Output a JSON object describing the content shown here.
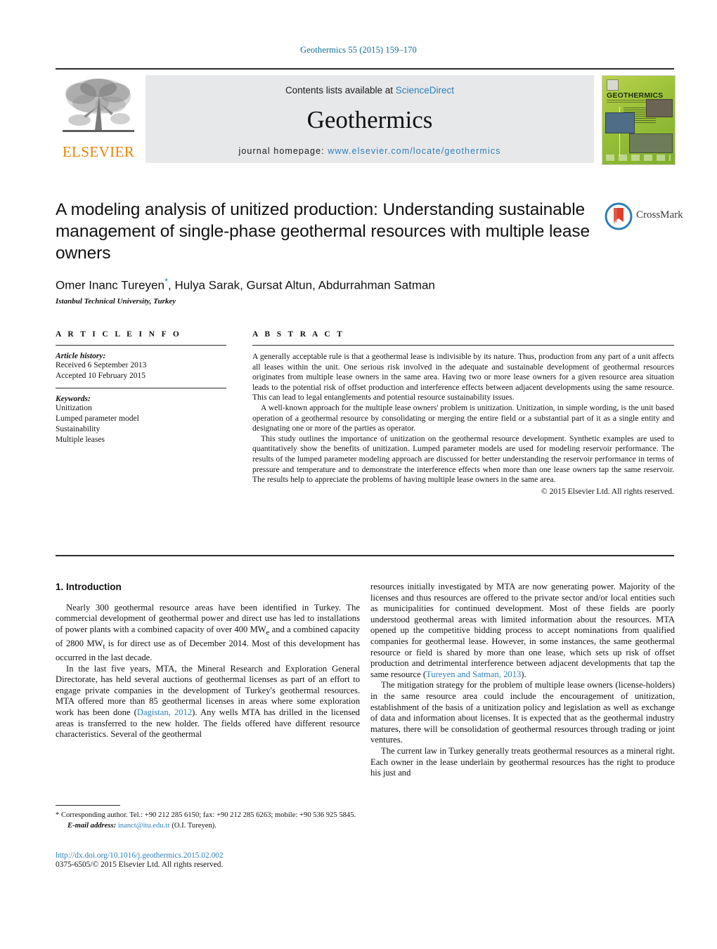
{
  "running_head": "Geothermics 55 (2015) 159–170",
  "masthead": {
    "contents_prefix": "Contents lists available at ",
    "contents_link": "ScienceDirect",
    "journal_name": "Geothermics",
    "homepage_label": "journal homepage:",
    "homepage_url": "www.elsevier.com/locate/geothermics",
    "publisher_logo_text": "ELSEVIER",
    "cover_title": "GEOTHERMICS"
  },
  "article": {
    "title": "A modeling analysis of unitized production: Understanding sustainable management of single-phase geothermal resources with multiple lease owners",
    "authors": "Omer Inanc Tureyen",
    "corresponding_marker": "*",
    "authors_rest": ", Hulya Sarak, Gursat Altun, Abdurrahman Satman",
    "affiliation": "Istanbul Technical University, Turkey",
    "crossmark_label": "CrossMark"
  },
  "article_info": {
    "heading": "A R T I C L E   I N F O",
    "history_label": "Article history:",
    "received": "Received 6 September 2013",
    "accepted": "Accepted 10 February 2015",
    "keywords_label": "Keywords:",
    "keywords": [
      "Unitization",
      "Lumped parameter model",
      "Sustainability",
      "Multiple leases"
    ]
  },
  "abstract": {
    "heading": "A B S T R A C T",
    "paragraphs": [
      "A generally acceptable rule is that a geothermal lease is indivisible by its nature. Thus, production from any part of a unit affects all leases within the unit. One serious risk involved in the adequate and sustainable development of geothermal resources originates from multiple lease owners in the same area. Having two or more lease owners for a given resource area situation leads to the potential risk of offset production and interference effects between adjacent developments using the same resource. This can lead to legal entanglements and potential resource sustainability issues.",
      "A well-known approach for the multiple lease owners' problem is unitization. Unitization, in simple wording, is the unit based operation of a geothermal resource by consolidating or merging the entire field or a substantial part of it as a single entity and designating one or more of the parties as operator.",
      "This study outlines the importance of unitization on the geothermal resource development. Synthetic examples are used to quantitatively show the benefits of unitization. Lumped parameter models are used for modeling reservoir performance. The results of the lumped parameter modeling approach are discussed for better understanding the reservoir performance in terms of pressure and temperature and to demonstrate the interference effects when more than one lease owners tap the same reservoir. The results help to appreciate the problems of having multiple lease owners in the same area."
    ],
    "copyright": "© 2015 Elsevier Ltd. All rights reserved."
  },
  "body": {
    "section_heading": "1. Introduction",
    "left_paragraphs": [
      "Nearly 300 geothermal resource areas have been identified in Turkey. The commercial development of geothermal power and direct use has led to installations of power plants with a combined capacity of over 400 MWe and a combined capacity of 2800 MWt is for direct use as of December 2014. Most of this development has occurred in the last decade.",
      "In the last five years, MTA, the Mineral Research and Exploration General Directorate, has held several auctions of geothermal licenses as part of an effort to engage private companies in the development of Turkey's geothermal resources. MTA offered more than 85 geothermal licenses in areas where some exploration work has been done (Dagistan, 2012). Any wells MTA has drilled in the licensed areas is transferred to the new holder. The fields offered have different resource characteristics. Several of the geothermal"
    ],
    "left_ref_link": "Dagistan, 2012",
    "right_paragraphs": [
      "resources initially investigated by MTA are now generating power. Majority of the licenses and thus resources are offered to the private sector and/or local entities such as municipalities for continued development. Most of these fields are poorly understood geothermal areas with limited information about the resources. MTA opened up the competitive bidding process to accept nominations from qualified companies for geothermal lease. However, in some instances, the same geothermal resource or field is shared by more than one lease, which sets up risk of offset production and detrimental interference between adjacent developments that tap the same resource (Tureyen and Satman, 2013).",
      "The mitigation strategy for the problem of multiple lease owners (license-holders) in the same resource area could include the encouragement of unitization, establishment of the basis of a unitization policy and legislation as well as exchange of data and information about licenses. It is expected that as the geothermal industry matures, there will be consolidation of geothermal resources through trading or joint ventures.",
      "The current law in Turkey generally treats geothermal resources as a mineral right. Each owner in the lease underlain by geothermal resources has the right to produce his just and"
    ],
    "right_ref_link": "Tureyen and Satman, 2013"
  },
  "footnote": {
    "corresponding": "* Corresponding author. Tel.: +90 212 285 6150; fax: +90 212 285 6263; mobile: +90 536 925 5845.",
    "email_label": "E-mail address:",
    "email": "inanct@itu.edu.tr",
    "email_owner": "(O.I. Tureyen)."
  },
  "footer": {
    "doi": "http://dx.doi.org/10.1016/j.geothermics.2015.02.002",
    "issn_line": "0375-6505/© 2015 Elsevier Ltd. All rights reserved."
  },
  "colors": {
    "link": "#2e7eb8",
    "elsevier_orange": "#f08000",
    "runhead": "#0b6c9c"
  }
}
